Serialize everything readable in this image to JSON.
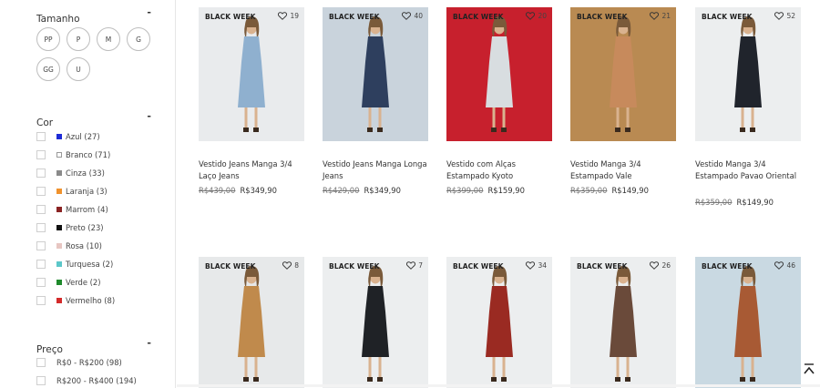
{
  "filters": {
    "size": {
      "title": "Tamanho",
      "toggle": "-",
      "options": [
        "PP",
        "P",
        "M",
        "G",
        "GG",
        "U"
      ]
    },
    "color": {
      "title": "Cor",
      "toggle": "-",
      "options": [
        {
          "label": "Azul (27)",
          "swatch": "#1e2cd6"
        },
        {
          "label": "Branco (71)",
          "swatch": "#ffffff"
        },
        {
          "label": "Cinza (33)",
          "swatch": "#8a8a8a"
        },
        {
          "label": "Laranja (3)",
          "swatch": "#f0922d"
        },
        {
          "label": "Marrom (4)",
          "swatch": "#8a2323"
        },
        {
          "label": "Preto (23)",
          "swatch": "#111111"
        },
        {
          "label": "Rosa (10)",
          "swatch": "#e7c6c2"
        },
        {
          "label": "Turquesa (2)",
          "swatch": "#5cc7c9"
        },
        {
          "label": "Verde (2)",
          "swatch": "#1f8a2c"
        },
        {
          "label": "Vermelho (8)",
          "swatch": "#d42a2a"
        }
      ]
    },
    "price": {
      "title": "Preço",
      "toggle": "-",
      "options": [
        "R$0 - R$200 (98)",
        "R$200 - R$400 (194)"
      ]
    }
  },
  "products": [
    {
      "badge": "BLACK WEEK",
      "likes": "19",
      "title": "Vestido Jeans Manga 3/4 Laço Jeans",
      "old_price": "R$439,00",
      "price": "R$349,90",
      "bg": "#e9ebed",
      "dress": "#8fb0cf"
    },
    {
      "badge": "BLACK WEEK",
      "likes": "40",
      "title": "Vestido Jeans Manga Longa Jeans",
      "old_price": "R$429,00",
      "price": "R$349,90",
      "bg": "#c9d3dc",
      "dress": "#2e3f5e"
    },
    {
      "badge": "BLACK WEEK",
      "likes": "20",
      "title": "Vestido com Alças Estampado Kyoto",
      "old_price": "R$399,00",
      "price": "R$159,90",
      "bg": "#c7202d",
      "dress": "#d8dde0"
    },
    {
      "badge": "BLACK WEEK",
      "likes": "21",
      "title": "Vestido Manga 3/4 Estampado Vale",
      "old_price": "R$359,00",
      "price": "R$149,90",
      "bg": "#b98a52",
      "dress": "#c78a5c"
    },
    {
      "badge": "BLACK WEEK",
      "likes": "52",
      "title": "Vestido Manga 3/4 Estampado Pavao Oriental",
      "old_price": "R$359,00",
      "price": "R$149,90",
      "bg": "#eceeef",
      "dress": "#20242c"
    },
    {
      "badge": "BLACK WEEK",
      "likes": "8",
      "title": "",
      "old_price": "",
      "price": "",
      "bg": "#e7e9ea",
      "dress": "#c08a4c"
    },
    {
      "badge": "BLACK WEEK",
      "likes": "7",
      "title": "",
      "old_price": "",
      "price": "",
      "bg": "#eceeef",
      "dress": "#1f2226"
    },
    {
      "badge": "BLACK WEEK",
      "likes": "34",
      "title": "",
      "old_price": "",
      "price": "",
      "bg": "#eceeef",
      "dress": "#9a2a22"
    },
    {
      "badge": "BLACK WEEK",
      "likes": "26",
      "title": "",
      "old_price": "",
      "price": "",
      "bg": "#eceeef",
      "dress": "#6a4a3a"
    },
    {
      "badge": "BLACK WEEK",
      "likes": "46",
      "title": "",
      "old_price": "",
      "price": "",
      "bg": "#c9d9e2",
      "dress": "#a85a34"
    }
  ]
}
